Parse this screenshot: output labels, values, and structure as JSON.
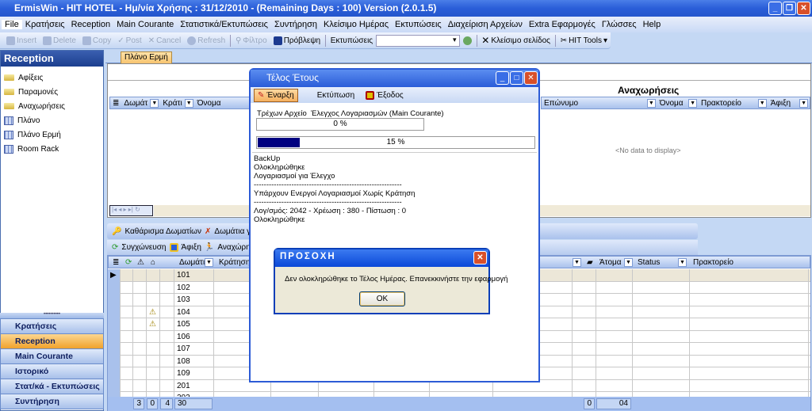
{
  "window": {
    "title": "ErmisWin - HIT HOTEL  - Ημ/νία Χρήσης : 31/12/2010 - (Remaining Days : 100) Version (2.0.1.5)"
  },
  "menu": [
    "File",
    "Κρατήσεις",
    "Reception",
    "Main Courante",
    "Στατιστικά/Εκτυπώσεις",
    "Συντήρηση",
    "Κλείσιμο Ημέρας",
    "Εκτυπώσεις",
    "Διαχείριση Αρχείων",
    "Extra Εφαρμογές",
    "Γλώσσες",
    "Help"
  ],
  "toolbar": {
    "insert": "Insert",
    "delete": "Delete",
    "copy": "Copy",
    "post": "Post",
    "cancel": "Cancel",
    "refresh": "Refresh",
    "filter": "Φίλτρο",
    "forecast": "Πρόβλεψη",
    "prints_label": "Εκτυπώσεις",
    "prints_value": "",
    "close_page": "Κλείσιμο σελίδος",
    "hit_tools": "HIT Tools"
  },
  "sidebar": {
    "header": "Reception",
    "items": [
      "Αφίξεις",
      "Παραμονές",
      "Αναχωρήσεις",
      "Πλάνο",
      "Πλάνο Ερμή",
      "Room Rack"
    ],
    "nav": [
      "Κρατήσεις",
      "Reception",
      "Main Courante",
      "Ιστορικό",
      "Στατ/κά - Εκτυπώσεις",
      "Συντήρηση"
    ],
    "active_nav": "Reception"
  },
  "tab": "Πλάνο Ερμή",
  "upper_left_grid": {
    "columns": [
      "Δωμάτ",
      "Κράτι",
      "Όνομα"
    ]
  },
  "departures": {
    "title": "Αναχωρήσεις",
    "columns": [
      "Επώνυμο",
      "Όνομα",
      "Πρακτορείο",
      "Άφιξη"
    ],
    "empty": "<No data to display>"
  },
  "lower_toolbar": {
    "clean": "Καθάρισμα Δωματίων",
    "rooms_for": "Δωμάτια για Κ",
    "merge": "Συγχώνευση",
    "arrival": "Άφιξη",
    "departure": "Αναχώρηση"
  },
  "lower_grid": {
    "columns": [
      "Δωμάτιο",
      "Κράτηση",
      "Άτομα",
      "Status",
      "Πρακτορείο"
    ],
    "rooms": [
      "101",
      "102",
      "103",
      "104",
      "105",
      "106",
      "107",
      "108",
      "109",
      "201",
      "202"
    ],
    "footer": {
      "c1": "3",
      "c2": "0",
      "c3": "4",
      "c4": "30",
      "c5": "0",
      "c6": "04"
    }
  },
  "dialog": {
    "title": "Τέλος Έτους",
    "start": "Έναρξη",
    "print": "Εκτύπωση",
    "exit": "Έξοδος",
    "current_file_label": "Τρέχων Αρχείο",
    "current_file": "Έλεγχος Λογαριασμών (Main Courante)",
    "progress1": "0 %",
    "progress2": "15 %",
    "progress2_value": 15,
    "log": [
      "BackUp",
      "Ολοκληρώθηκε",
      "Λογαριασμοί για Έλεγχο",
      "-----------------------------------------------------------",
      "Υπάρχουν Ενεργοί Λογαριασμοί Χωρίς Κράτηση",
      "-----------------------------------------------------------",
      "Λογ/σμός: 2042 - Χρέωση  : 380 - Πίστωση : 0",
      "Ολοκληρώθηκε"
    ]
  },
  "alert": {
    "title": "ΠΡΟΣΟΧΗ",
    "message": "Δεν ολοκληρώθηκε το Τέλος Ημέρας. Επανεκκινήστε την εφαρμογή",
    "ok": "OK"
  },
  "colors": {
    "title_blue": "#2a5ed8",
    "active_nav": "#f0a22c",
    "progress_fill": "#000080"
  }
}
